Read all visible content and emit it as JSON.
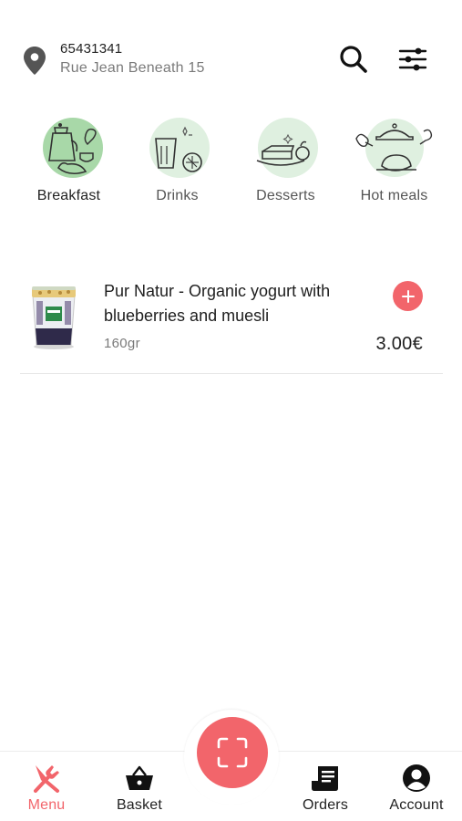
{
  "header": {
    "address_code": "65431341",
    "address_street": "Rue Jean Beneath 15",
    "location_icon": "map-pin-icon",
    "search_icon": "search-icon",
    "filter_icon": "sliders-icon"
  },
  "categories": [
    {
      "label": "Breakfast",
      "icon": "breakfast-illustration",
      "active": true
    },
    {
      "label": "Drinks",
      "icon": "drinks-illustration",
      "active": false
    },
    {
      "label": "Desserts",
      "icon": "desserts-illustration",
      "active": false
    },
    {
      "label": "Hot meals",
      "icon": "hot-meals-illustration",
      "active": false
    }
  ],
  "products": [
    {
      "name": "Pur Natur - Organic yogurt with blueberries and muesli",
      "weight": "160gr",
      "price": "3.00€",
      "add_icon": "plus-icon"
    }
  ],
  "bottom_nav": {
    "items": [
      {
        "label": "Menu",
        "icon": "fork-knife-icon",
        "active": true
      },
      {
        "label": "Basket",
        "icon": "basket-icon",
        "active": false
      },
      {
        "label": "Orders",
        "icon": "receipt-icon",
        "active": false
      },
      {
        "label": "Account",
        "icon": "account-icon",
        "active": false
      }
    ],
    "scan_icon": "scan-icon"
  },
  "colors": {
    "accent": "#f2656b",
    "category_circle": "#dff0e0",
    "category_circle_active": "#a8d8a8",
    "text_primary": "#1e1e1e",
    "text_secondary": "#7a7a7a"
  }
}
